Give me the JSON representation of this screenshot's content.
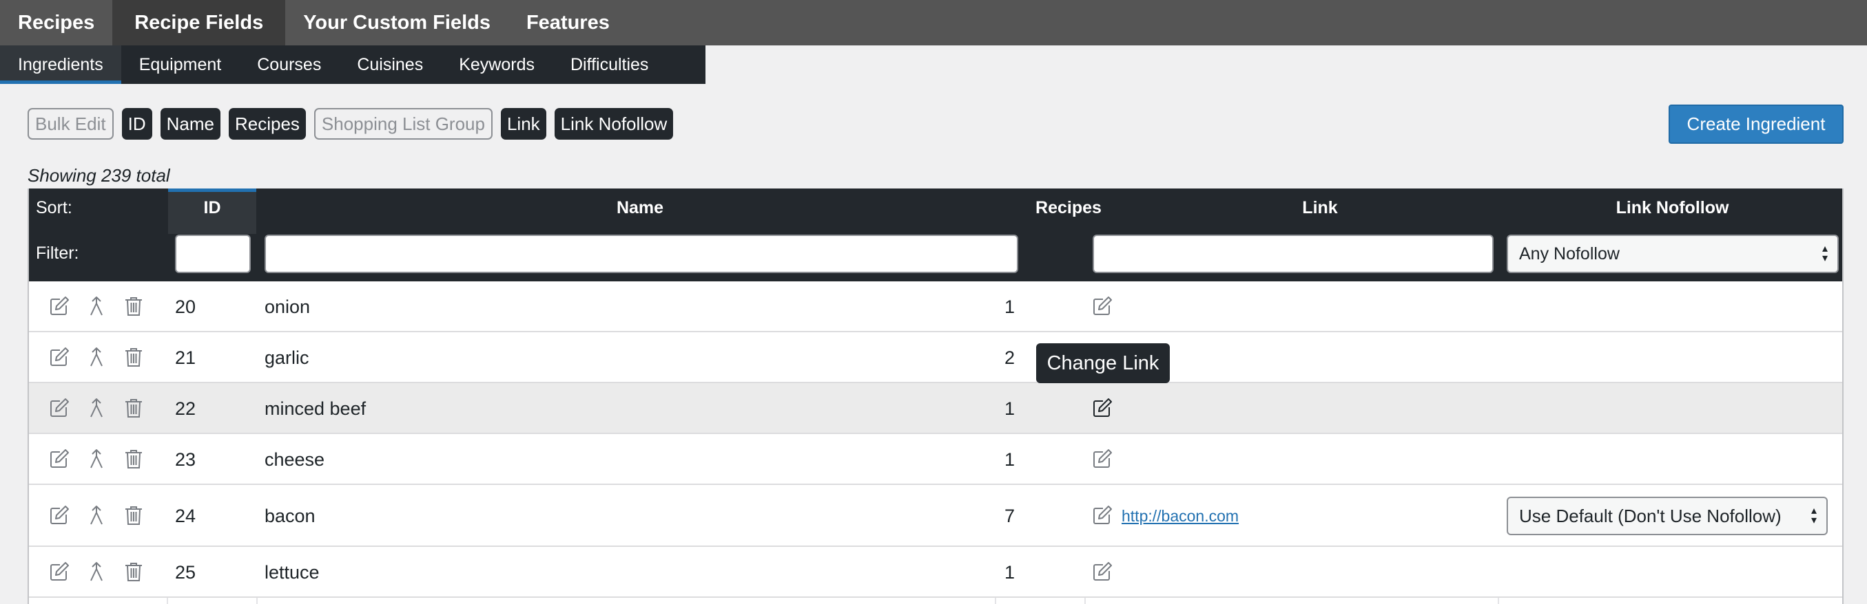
{
  "top_tabs": [
    {
      "label": "Recipes"
    },
    {
      "label": "Recipe Fields"
    },
    {
      "label": "Your Custom Fields"
    },
    {
      "label": "Features"
    }
  ],
  "sub_tabs": [
    {
      "label": "Ingredients"
    },
    {
      "label": "Equipment"
    },
    {
      "label": "Courses"
    },
    {
      "label": "Cuisines"
    },
    {
      "label": "Keywords"
    },
    {
      "label": "Difficulties"
    }
  ],
  "column_toggles": [
    {
      "label": "Bulk Edit",
      "active": false
    },
    {
      "label": "ID",
      "active": true
    },
    {
      "label": "Name",
      "active": true
    },
    {
      "label": "Recipes",
      "active": true
    },
    {
      "label": "Shopping List Group",
      "active": false
    },
    {
      "label": "Link",
      "active": true
    },
    {
      "label": "Link Nofollow",
      "active": true
    }
  ],
  "create_button": "Create Ingredient",
  "showing_text": "Showing 239 total",
  "table": {
    "sort_label": "Sort:",
    "filter_label": "Filter:",
    "columns": {
      "id": "ID",
      "name": "Name",
      "recipes": "Recipes",
      "link": "Link",
      "nofollow": "Link Nofollow"
    },
    "nofollow_filter": "Any Nofollow",
    "rows": [
      {
        "id": "20",
        "name": "onion",
        "recipes": "1",
        "link": "",
        "nofollow": ""
      },
      {
        "id": "21",
        "name": "garlic",
        "recipes": "2",
        "link": "",
        "nofollow": ""
      },
      {
        "id": "22",
        "name": "minced beef",
        "recipes": "1",
        "link": "",
        "nofollow": ""
      },
      {
        "id": "23",
        "name": "cheese",
        "recipes": "1",
        "link": "",
        "nofollow": ""
      },
      {
        "id": "24",
        "name": "bacon",
        "recipes": "7",
        "link": "http://bacon.com",
        "nofollow": "Use Default (Don't Use Nofollow)"
      },
      {
        "id": "25",
        "name": "lettuce",
        "recipes": "1",
        "link": "",
        "nofollow": ""
      }
    ]
  },
  "tooltip": "Change Link",
  "icons": {
    "edit": "pencil-square-icon",
    "merge": "merge-arrow-icon",
    "delete": "trash-icon"
  }
}
